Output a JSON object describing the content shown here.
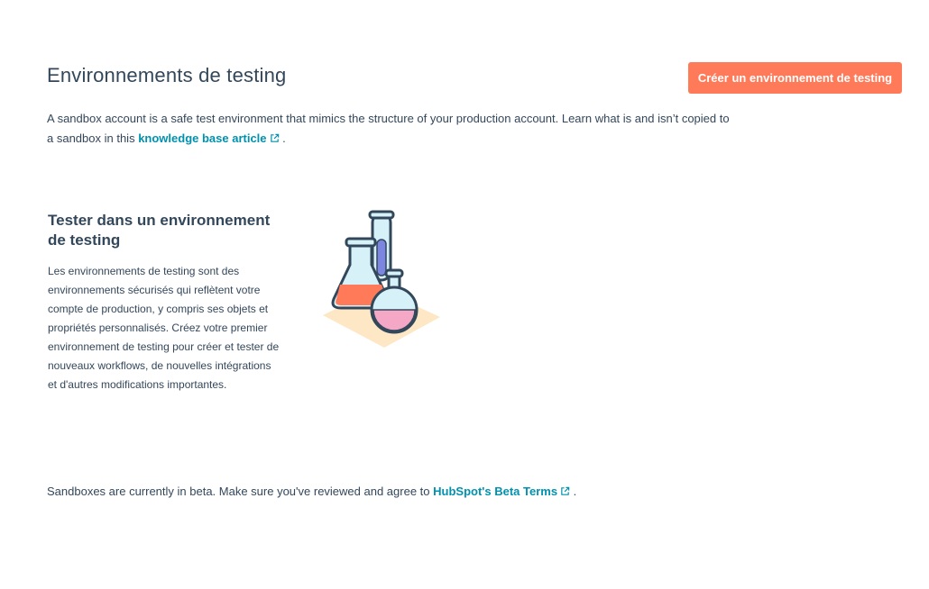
{
  "header": {
    "title": "Environnements de testing",
    "create_button_label": "Créer un environnement de testing"
  },
  "intro": {
    "text_before": "A sandbox account is a safe test environment that mimics the structure of your production account. Learn what is and isn’t copied to a sandbox in this ",
    "link_label": "knowledge base article",
    "text_after": " ."
  },
  "empty_state": {
    "title": "Tester dans un environnement de testing",
    "description": "Les environnements de testing sont des environnements sécurisés qui reflètent votre compte de production, y compris ses objets et propriétés personnalisés. Créez votre premier environnement de testing pour créer et tester de nouveaux workflows, de nouvelles intégrations et d'autres modifications importantes.",
    "illustration_icon": "lab-flasks-icon"
  },
  "footer": {
    "text_before": "Sandboxes are currently in beta. Make sure you've reviewed and agree to ",
    "link_label": "HubSpot's Beta Terms",
    "text_after": " ."
  },
  "colors": {
    "accent": "#ff7a59",
    "link": "#0091ae",
    "text": "#33475b"
  }
}
